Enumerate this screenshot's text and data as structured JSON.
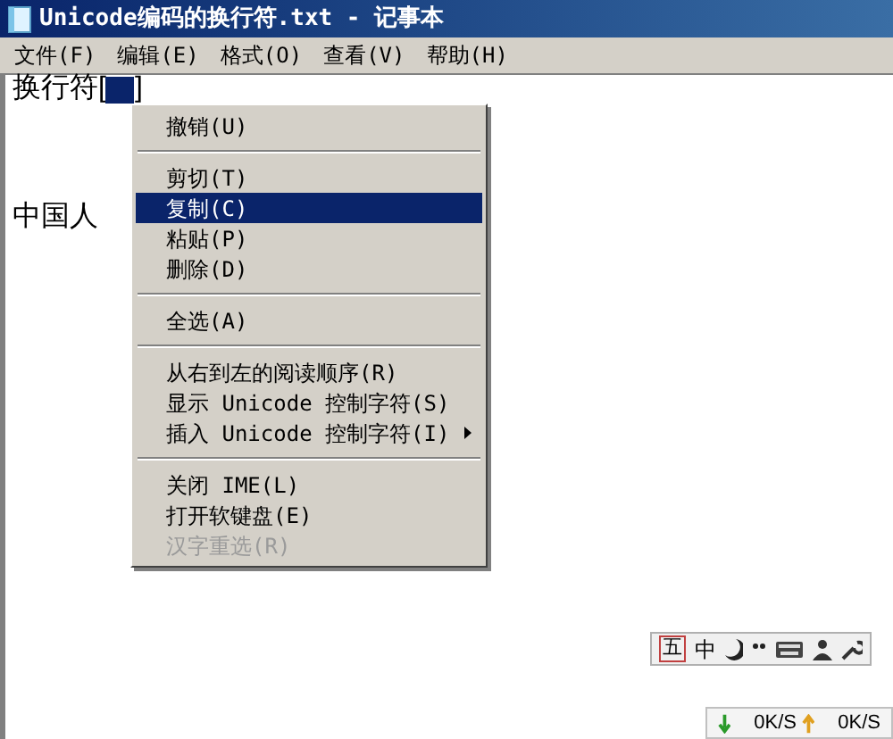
{
  "window": {
    "title": "Unicode编码的换行符.txt - 记事本"
  },
  "menu_bar": [
    {
      "label": "文件(F)"
    },
    {
      "label": "编辑(E)"
    },
    {
      "label": "格式(O)"
    },
    {
      "label": "查看(V)"
    },
    {
      "label": "帮助(H)"
    }
  ],
  "document": {
    "line_1_before": "换行符[",
    "line_1_after": "]",
    "line_2": "中国人"
  },
  "context_menu": {
    "items": [
      {
        "kind": "item",
        "label": "撤销(U)",
        "selected": false,
        "disabled": false,
        "submenu": false
      },
      {
        "kind": "separator"
      },
      {
        "kind": "item",
        "label": "剪切(T)",
        "selected": false,
        "disabled": false,
        "submenu": false
      },
      {
        "kind": "item",
        "label": "复制(C)",
        "selected": true,
        "disabled": false,
        "submenu": false
      },
      {
        "kind": "item",
        "label": "粘贴(P)",
        "selected": false,
        "disabled": false,
        "submenu": false
      },
      {
        "kind": "item",
        "label": "删除(D)",
        "selected": false,
        "disabled": false,
        "submenu": false
      },
      {
        "kind": "separator"
      },
      {
        "kind": "item",
        "label": "全选(A)",
        "selected": false,
        "disabled": false,
        "submenu": false
      },
      {
        "kind": "separator"
      },
      {
        "kind": "item",
        "label": "从右到左的阅读顺序(R)",
        "selected": false,
        "disabled": false,
        "submenu": false
      },
      {
        "kind": "item",
        "label": "显示 Unicode 控制字符(S)",
        "selected": false,
        "disabled": false,
        "submenu": false
      },
      {
        "kind": "item",
        "label": "插入 Unicode 控制字符(I)",
        "selected": false,
        "disabled": false,
        "submenu": true
      },
      {
        "kind": "separator"
      },
      {
        "kind": "item",
        "label": "关闭 IME(L)",
        "selected": false,
        "disabled": false,
        "submenu": false
      },
      {
        "kind": "item",
        "label": "打开软键盘(E)",
        "selected": false,
        "disabled": false,
        "submenu": false
      },
      {
        "kind": "item",
        "label": "汉字重选(R)",
        "selected": false,
        "disabled": true,
        "submenu": false
      }
    ]
  },
  "ime_toolbar": {
    "input_mode": "五",
    "language": "中"
  },
  "net_speed": {
    "down": "0K/S",
    "up": "0K/S"
  }
}
